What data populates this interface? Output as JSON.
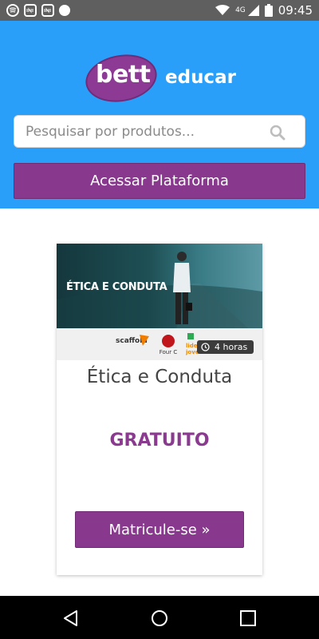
{
  "status_bar": {
    "apps": [
      "spotify-icon",
      "app-icon",
      "app-icon",
      "circle-icon"
    ],
    "network": "4G",
    "time": "09:45"
  },
  "header": {
    "logo": {
      "bett": "bett",
      "educar": "educar"
    },
    "search_placeholder": "Pesquisar por produtos...",
    "platform_button": "Acessar Plataforma",
    "colors": {
      "background": "#2a9ffa",
      "accent": "#88398d"
    }
  },
  "card": {
    "image_title": "ÉTICA E CONDUTA",
    "partner_logos": {
      "scaffold": "scaffold"
    },
    "duration": "4 horas",
    "title": "Ética e Conduta",
    "price": "GRATUITO",
    "enroll_button": "Matricule-se »"
  },
  "nav_bar": {
    "buttons": [
      "back-icon",
      "home-icon",
      "recents-icon"
    ]
  }
}
